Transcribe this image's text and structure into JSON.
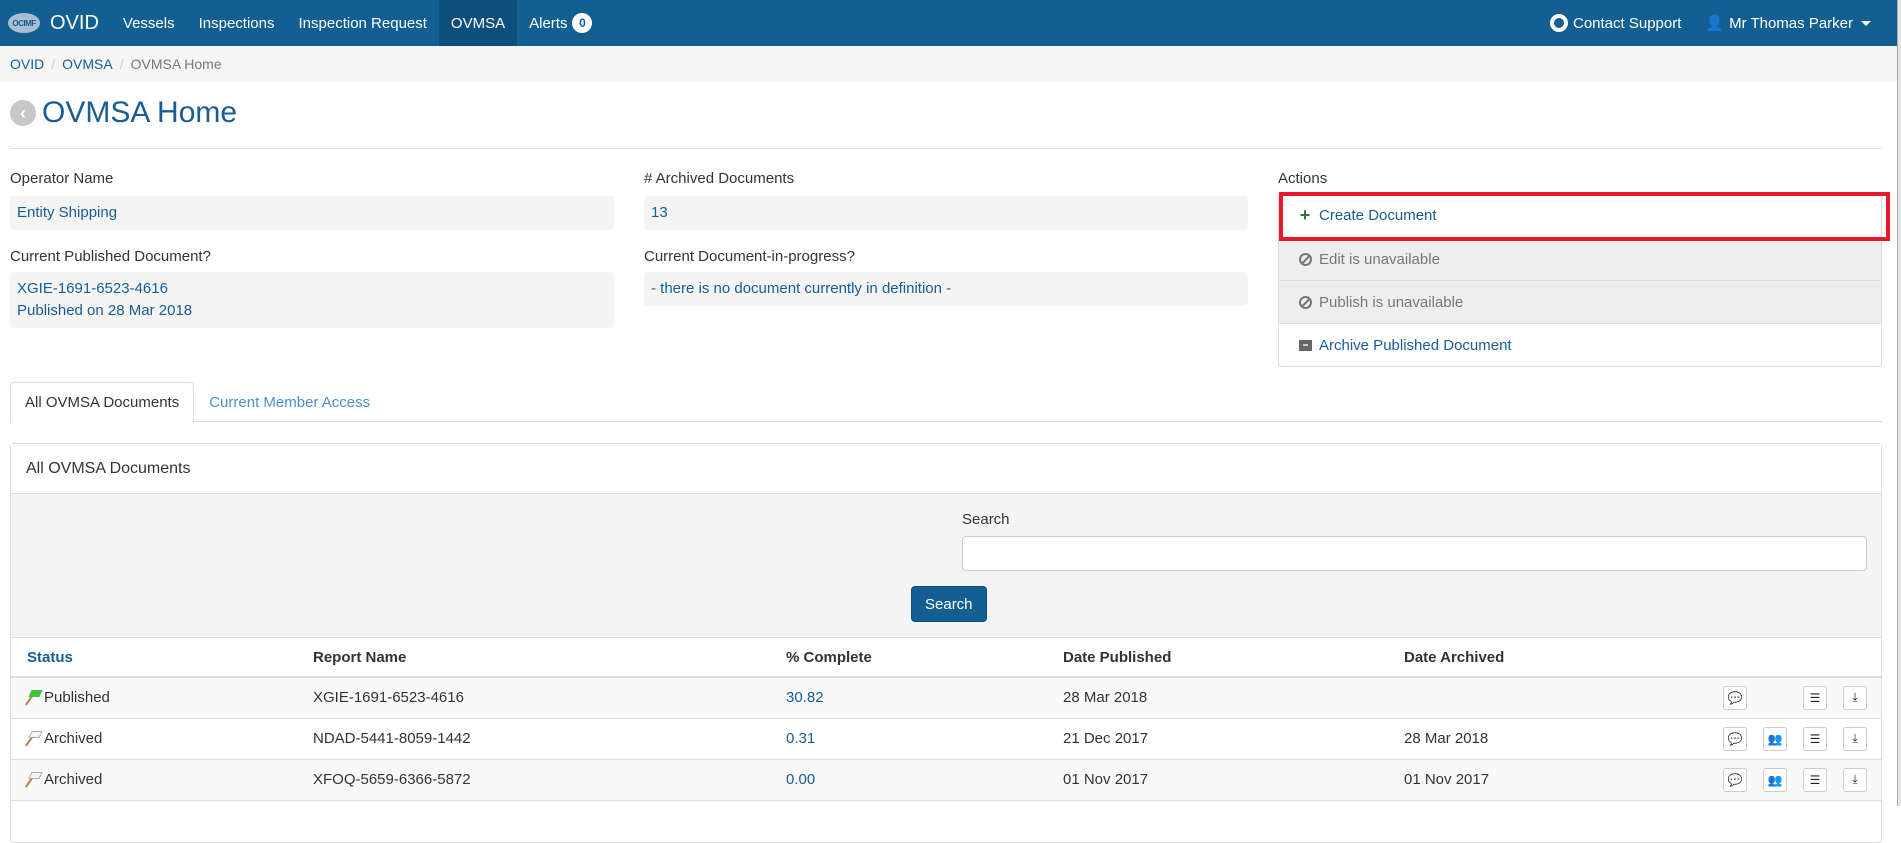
{
  "navbar": {
    "logo_text": "OCIMF",
    "brand": "OVID",
    "items": [
      {
        "label": "Vessels",
        "active": false
      },
      {
        "label": "Inspections",
        "active": false
      },
      {
        "label": "Inspection Request",
        "active": false
      },
      {
        "label": "OVMSA",
        "active": true
      }
    ],
    "alerts_label": "Alerts",
    "alerts_count": "0",
    "contact_support": "Contact Support",
    "user_name": "Mr Thomas Parker"
  },
  "breadcrumb": [
    "OVID",
    "OVMSA",
    "OVMSA Home"
  ],
  "page_title": "OVMSA Home",
  "info": {
    "operator_label": "Operator Name",
    "operator_value": "Entity Shipping",
    "archived_label": "# Archived Documents",
    "archived_value": "13",
    "published_label": "Current Published Document?",
    "published_doc": "XGIE-1691-6523-4616",
    "published_date": "Published on 28 Mar 2018",
    "inprogress_label": "Current Document-in-progress?",
    "inprogress_value": "- there is no document currently in definition -"
  },
  "actions": {
    "label": "Actions",
    "items": [
      {
        "label": "Create Document",
        "icon": "plus-icon",
        "disabled": false
      },
      {
        "label": "Edit is unavailable",
        "icon": "ban-icon",
        "disabled": true
      },
      {
        "label": "Publish is unavailable",
        "icon": "ban-icon",
        "disabled": true
      },
      {
        "label": "Archive Published Document",
        "icon": "archive-icon",
        "disabled": false
      }
    ],
    "highlight_color": "#e8192c"
  },
  "tabs": [
    {
      "label": "All OVMSA Documents",
      "active": true
    },
    {
      "label": "Current Member Access",
      "active": false
    }
  ],
  "panel": {
    "title": "All OVMSA Documents",
    "search_label": "Search",
    "search_value": "",
    "search_button": "Search"
  },
  "table": {
    "columns": [
      "Status",
      "Report Name",
      "% Complete",
      "Date Published",
      "Date Archived"
    ],
    "rows": [
      {
        "status": "Published",
        "flag": "green",
        "report": "XGIE-1691-6523-4616",
        "complete": "30.82",
        "published": "28 Mar 2018",
        "archived": "",
        "has_members": false
      },
      {
        "status": "Archived",
        "flag": "white",
        "report": "NDAD-5441-8059-1442",
        "complete": "0.31",
        "published": "21 Dec 2017",
        "archived": "28 Mar 2018",
        "has_members": true
      },
      {
        "status": "Archived",
        "flag": "white",
        "report": "XFOQ-5659-6366-5872",
        "complete": "0.00",
        "published": "01 Nov 2017",
        "archived": "01 Nov 2017",
        "has_members": true
      }
    ]
  },
  "colors": {
    "navbar": "#135f92",
    "navbar_active": "#0e4e7c",
    "link": "#1a5c94"
  }
}
